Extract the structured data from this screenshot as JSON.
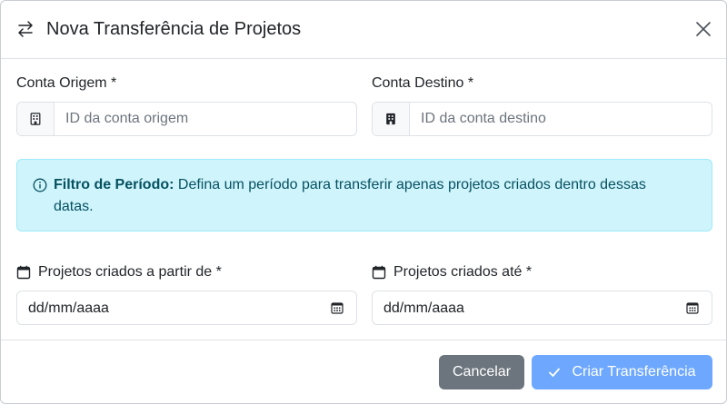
{
  "modal": {
    "title": "Nova Transferência de Projetos",
    "icons": {
      "title": "arrows-swap-icon",
      "close": "close-icon"
    }
  },
  "form": {
    "source": {
      "label": "Conta Origem *",
      "placeholder": "ID da conta origem",
      "value": "",
      "icon": "building-icon"
    },
    "destination": {
      "label": "Conta Destino *",
      "placeholder": "ID da conta destino",
      "value": "",
      "icon": "building-icon"
    },
    "alert": {
      "title": "Filtro de Período:",
      "text": " Defina um período para transferir apenas projetos criados dentro dessas datas.",
      "icon": "info-icon",
      "color": "#055160",
      "background": "#cff4fc"
    },
    "date_from": {
      "label": "Projetos criados a partir de *",
      "value": "dd/mm/aaaa",
      "icon": "calendar-icon"
    },
    "date_to": {
      "label": "Projetos criados até *",
      "value": "dd/mm/aaaa",
      "icon": "calendar-icon"
    }
  },
  "footer": {
    "cancel_label": "Cancelar",
    "submit_label": "Criar Transferência",
    "cancel_color": "#6c757d",
    "submit_color": "#6ea8fe",
    "submit_icon": "check-icon"
  }
}
